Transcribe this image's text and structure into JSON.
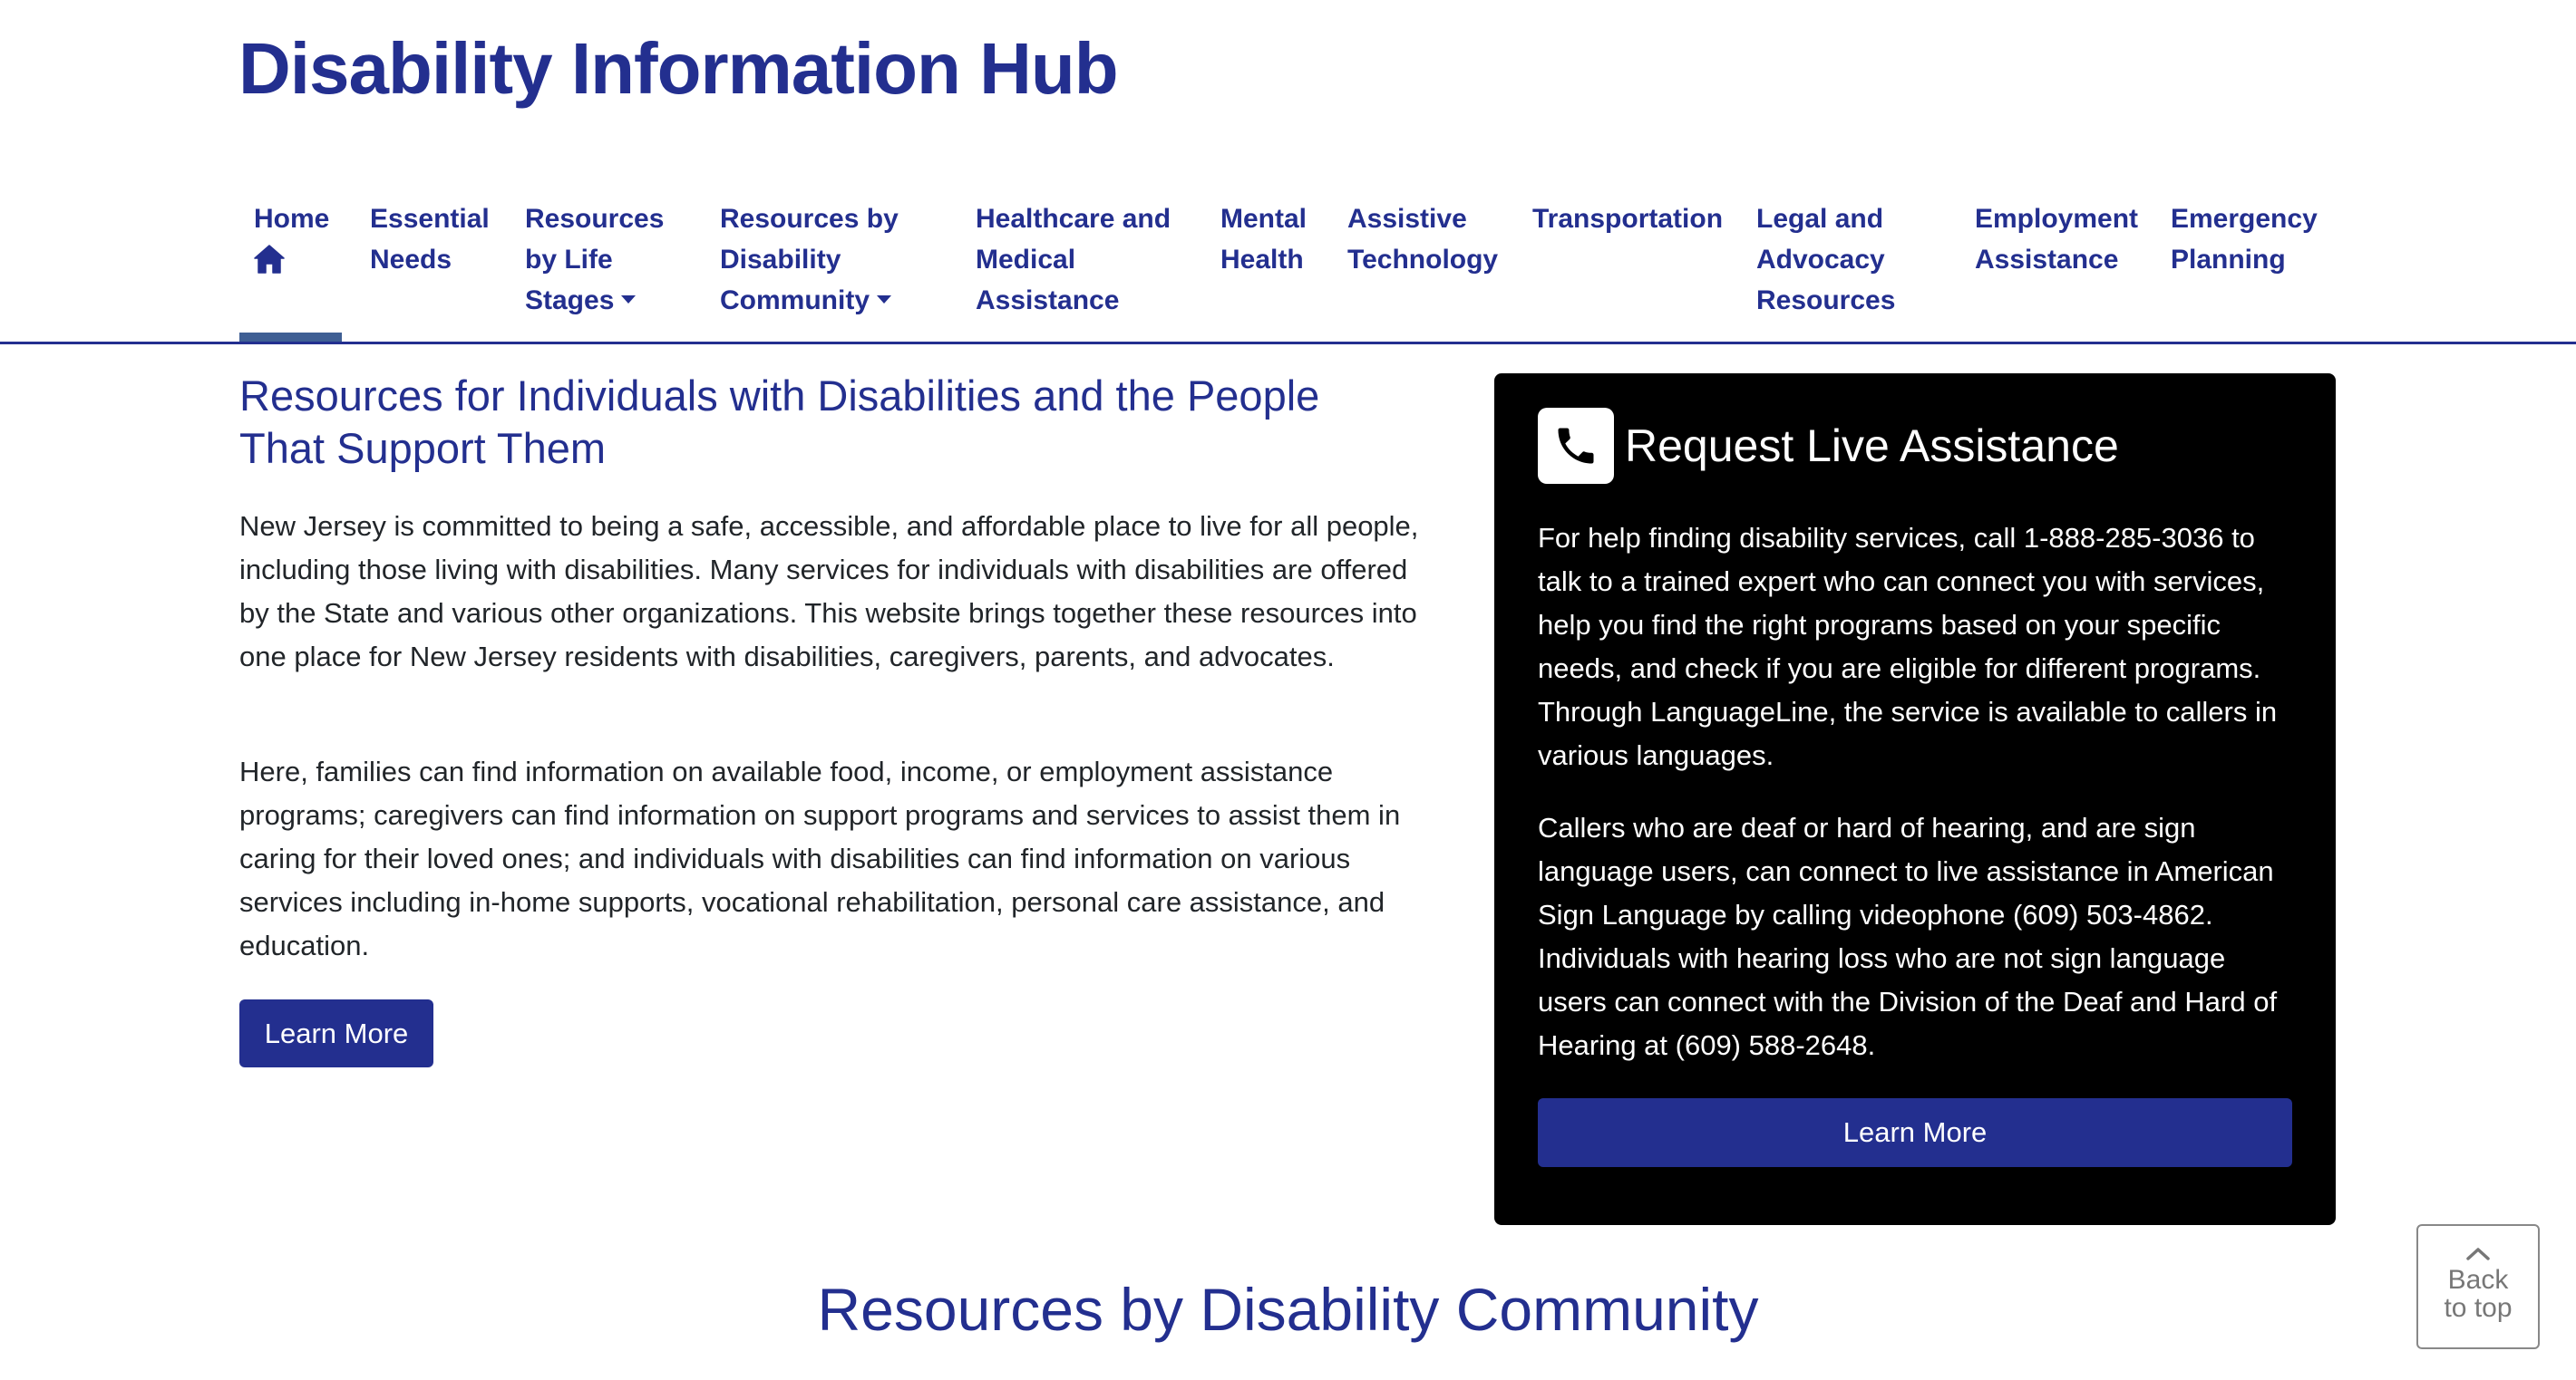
{
  "site": {
    "title": "Disability Information Hub"
  },
  "nav": {
    "items": [
      {
        "lines": [
          "Home"
        ],
        "icon": "home-icon",
        "active": true
      },
      {
        "lines": [
          "Essential",
          "Needs"
        ]
      },
      {
        "lines": [
          "Resources",
          "by Life",
          "Stages"
        ],
        "dropdown": true
      },
      {
        "lines": [
          "Resources by",
          "Disability",
          "Community"
        ],
        "dropdown": true
      },
      {
        "lines": [
          "Healthcare and",
          "Medical",
          "Assistance"
        ]
      },
      {
        "lines": [
          "Mental",
          "Health"
        ]
      },
      {
        "lines": [
          "Assistive",
          "Technology"
        ]
      },
      {
        "lines": [
          "Transportation"
        ]
      },
      {
        "lines": [
          "Legal and",
          "Advocacy",
          "Resources"
        ]
      },
      {
        "lines": [
          "Employment",
          "Assistance"
        ]
      },
      {
        "lines": [
          "Emergency",
          "Planning"
        ]
      }
    ]
  },
  "intro": {
    "heading": "Resources for Individuals with Disabilities and the People That Support Them",
    "paragraph_1": "New Jersey is committed to being a safe, accessible, and affordable place to live for all people, including those living with disabilities. Many services for individuals with disabilities are offered by the State and various other organizations. This website brings together these resources into one place for New Jersey residents with disabilities, caregivers, parents, and advocates.",
    "paragraph_2": "Here, families can find information on available food, income, or employment assistance programs; caregivers can find information on support programs and services to assist them in caring for their loved ones; and individuals with disabilities can find information on various services including in-home supports, vocational rehabilitation, personal care assistance, and education.",
    "button_label": "Learn More"
  },
  "live_assistance": {
    "icon": "phone-icon",
    "title": "Request Live Assistance",
    "paragraph_1": "For help finding disability services, call 1-888-285-3036 to talk to a trained expert who can connect you with services, help you find the right programs based on your specific needs, and check if you are eligible for different programs. Through LanguageLine, the service is available to callers in various languages.",
    "paragraph_2": "Callers who are deaf or hard of hearing, and are sign language users, can connect to live assistance in American Sign Language by calling videophone (609) 503-4862. Individuals with hearing loss who are not sign language users can connect with the Division of the Deaf and Hard of Hearing at (609) 588-2648.",
    "button_label": "Learn More"
  },
  "back_to_top": {
    "icon": "chevron-up-icon",
    "line_1": "Back",
    "line_2": "to top"
  },
  "section": {
    "heading": "Resources by Disability Community"
  },
  "colors": {
    "brand": "#232f8f",
    "active_indicator": "#3f5f94",
    "card_background": "#000000",
    "body_text": "#212529"
  }
}
